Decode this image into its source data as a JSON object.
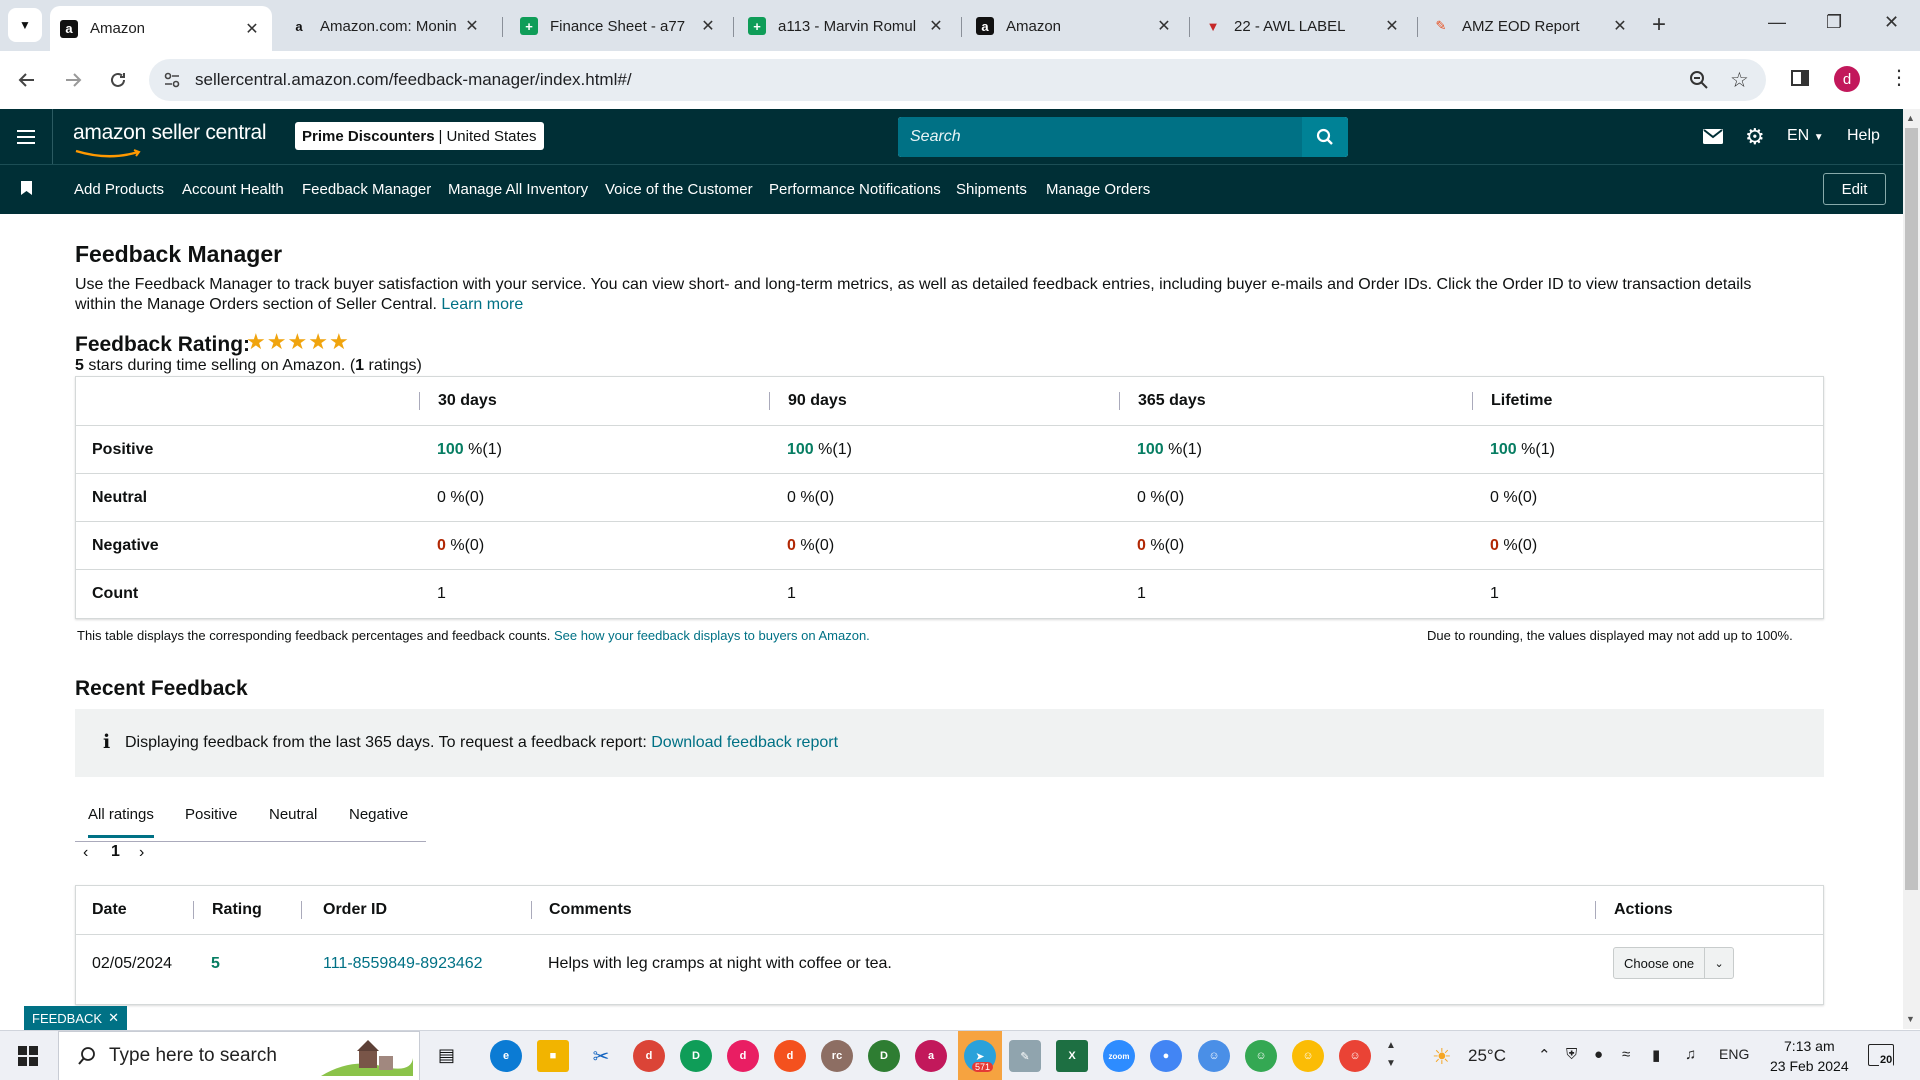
{
  "browser": {
    "tabs": [
      {
        "title": "Amazon",
        "favicon": "amazon-icon"
      },
      {
        "title": "Amazon.com: Monin",
        "favicon": "amazon-icon"
      },
      {
        "title": "Finance Sheet - a77",
        "favicon": "sheets-icon"
      },
      {
        "title": "a113 - Marvin Romul",
        "favicon": "sheets-icon"
      },
      {
        "title": "Amazon",
        "favicon": "amazon-icon"
      },
      {
        "title": "22 - AWL LABEL",
        "favicon": "label-icon"
      },
      {
        "title": "AMZ EOD Report",
        "favicon": "zoho-icon"
      }
    ],
    "url": "sellercentral.amazon.com/feedback-manager/index.html#/",
    "profile_initial": "d"
  },
  "header": {
    "logo": "amazon seller central",
    "store": "Prime Discounters",
    "marketplace": "United States",
    "search_placeholder": "Search",
    "language": "EN",
    "help": "Help"
  },
  "nav": {
    "items": [
      "Add Products",
      "Account Health",
      "Feedback Manager",
      "Manage All Inventory",
      "Voice of the Customer",
      "Performance Notifications",
      "Shipments",
      "Manage Orders"
    ],
    "edit": "Edit"
  },
  "page": {
    "title": "Feedback Manager",
    "description": "Use the Feedback Manager to track buyer satisfaction with your service. You can view short- and long-term metrics, as well as detailed feedback entries, including buyer e-mails and Order IDs. Click the Order ID to view transaction details within the Manage Orders section of Seller Central.",
    "learn_more": "Learn more",
    "rating_label": "Feedback Rating:",
    "rating_stars": 5,
    "rating_stars_text": "5",
    "rating_sub": "stars during time selling on Amazon. (",
    "rating_count": "1",
    "rating_sub_end": "ratings)"
  },
  "feedback_table": {
    "columns": [
      "30 days",
      "90 days",
      "365 days",
      "Lifetime"
    ],
    "rows": [
      {
        "label": "Positive",
        "values": [
          {
            "pct": "100",
            "rest": "%(1)"
          },
          {
            "pct": "100",
            "rest": "%(1)"
          },
          {
            "pct": "100",
            "rest": "%(1)"
          },
          {
            "pct": "100",
            "rest": "%(1)"
          }
        ]
      },
      {
        "label": "Neutral",
        "values": [
          {
            "pct": "0",
            "rest": "%(0)"
          },
          {
            "pct": "0",
            "rest": "%(0)"
          },
          {
            "pct": "0",
            "rest": "%(0)"
          },
          {
            "pct": "0",
            "rest": "%(0)"
          }
        ]
      },
      {
        "label": "Negative",
        "values": [
          {
            "pct": "0",
            "rest": "%(0)"
          },
          {
            "pct": "0",
            "rest": "%(0)"
          },
          {
            "pct": "0",
            "rest": "%(0)"
          },
          {
            "pct": "0",
            "rest": "%(0)"
          }
        ]
      },
      {
        "label": "Count",
        "values": [
          {
            "pct": "",
            "rest": "1"
          },
          {
            "pct": "",
            "rest": "1"
          },
          {
            "pct": "",
            "rest": "1"
          },
          {
            "pct": "",
            "rest": "1"
          }
        ]
      }
    ],
    "note": "This table displays the corresponding feedback percentages and feedback counts.",
    "note_link": "See how your feedback displays to buyers on Amazon.",
    "rounding_note": "Due to rounding, the values displayed may not add up to 100%."
  },
  "recent": {
    "title": "Recent Feedback",
    "info": "Displaying feedback from the last 365 days. To request a feedback report:",
    "download": "Download feedback report",
    "tabs": [
      "All ratings",
      "Positive",
      "Neutral",
      "Negative"
    ],
    "page": "1",
    "columns": [
      "Date",
      "Rating",
      "Order ID",
      "Comments",
      "Actions"
    ],
    "rows": [
      {
        "date": "02/05/2024",
        "rating": "5",
        "order_id": "111-8559849-8923462",
        "comment": "Helps with leg cramps at night with coffee or tea.",
        "action": "Choose one"
      }
    ],
    "feedback_tag": "FEEDBACK"
  },
  "taskbar": {
    "search_placeholder": "Type here to search",
    "badge": "571",
    "weather": "25°C",
    "language": "ENG",
    "time": "7:13 am",
    "date": "23 Feb 2024",
    "notifications": "20"
  },
  "colors": {
    "header_bg": "#002f36",
    "link": "#007185",
    "positive": "#067d62",
    "negative": "#b12704",
    "star": "#f0a40e"
  }
}
